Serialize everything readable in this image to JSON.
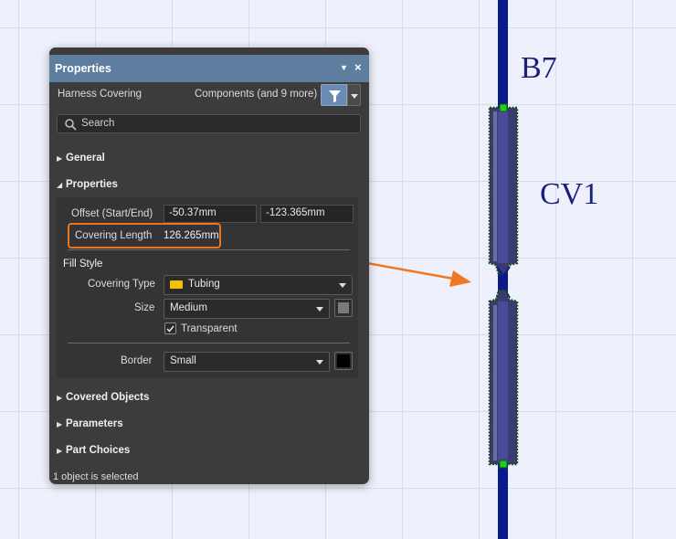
{
  "panel": {
    "title": "Properties",
    "object_type": "Harness Covering",
    "filter_label": "Components (and 9 more)",
    "search_placeholder": "Search",
    "sections": {
      "general": "General",
      "properties": "Properties",
      "covered_objects": "Covered Objects",
      "parameters": "Parameters",
      "part_choices": "Part Choices"
    },
    "offset": {
      "label": "Offset (Start/End)",
      "start": "-50.37mm",
      "end": "-123.365mm"
    },
    "covering_length": {
      "label": "Covering Length",
      "value": "126.265mm"
    },
    "fill_style": {
      "heading": "Fill Style",
      "covering_type_label": "Covering Type",
      "covering_type_value": "Tubing",
      "covering_type_color": "#f2c100",
      "size_label": "Size",
      "size_value": "Medium",
      "size_color": "#7a7a7a",
      "transparent_label": "Transparent",
      "transparent_checked": true,
      "border_label": "Border",
      "border_value": "Small",
      "border_color": "#000000"
    },
    "status": "1 object is selected"
  },
  "canvas": {
    "wire_label": "B7",
    "covering_label": "CV1",
    "wire_color": "#0a1a8c",
    "covering_fill": "#4a4a8a",
    "covering_border": "#2f6b2f",
    "handle_color": "#22cc22",
    "callout_color": "#f07820"
  }
}
